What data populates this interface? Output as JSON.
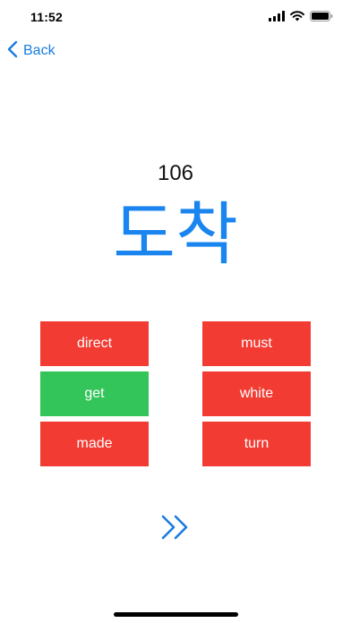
{
  "status_bar": {
    "time": "11:52"
  },
  "nav": {
    "back_label": "Back"
  },
  "card": {
    "number": "106",
    "word": "도착"
  },
  "answers": [
    {
      "label": "direct",
      "state": "wrong"
    },
    {
      "label": "must",
      "state": "wrong"
    },
    {
      "label": "get",
      "state": "correct"
    },
    {
      "label": "white",
      "state": "wrong"
    },
    {
      "label": "made",
      "state": "wrong"
    },
    {
      "label": "turn",
      "state": "wrong"
    }
  ],
  "colors": {
    "accent": "#1a7ce0",
    "word": "#1a85ee",
    "wrong": "#f23b33",
    "correct": "#34c55a"
  },
  "icons": {
    "back": "chevron-left-icon",
    "next": "double-chevron-right-icon"
  }
}
